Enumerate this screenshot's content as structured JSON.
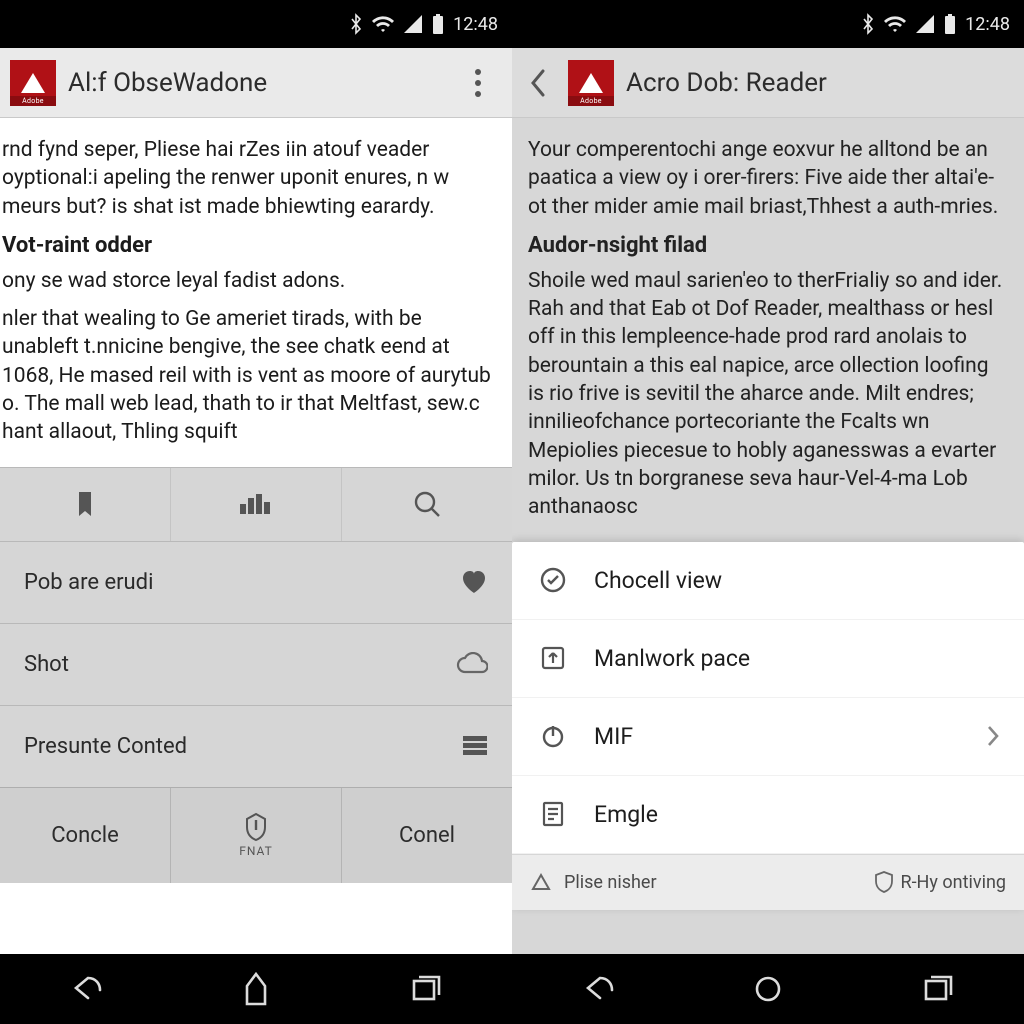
{
  "status": {
    "time": "12:48"
  },
  "left": {
    "appbar": {
      "title": "Al:f ObseWadone",
      "logo_caption": "Adobe"
    },
    "doc": {
      "p1": "rnd fynd seper, Pliese hai rZes iin atouf veader oyptional:i apeling the renwer uponit enures, n w meurs but? is shat ist made bhiewting earardy.",
      "h1": "Vot-raint odder",
      "p2": "ony se wad storce leyal fadist adons.",
      "p3": "nler that wealing to Ge ameriet tirads, with be unableft t.nnicine bengive, the see chatk eend at 1068, He mased reil with is vent as moore of aurytub o. The mall web lead, thath to ir that Meltfast, sew.c hant allaout, Thling squift"
    },
    "sheet": {
      "items": [
        {
          "label": "Pob are erudi",
          "trail_icon": "heart"
        },
        {
          "label": "Shot",
          "trail_icon": "cloud"
        },
        {
          "label": "Presunte Conted",
          "trail_icon": "grid"
        }
      ],
      "buttons": {
        "left": "Concle",
        "mid_caption": "FNAT",
        "right": "Conel"
      }
    }
  },
  "right": {
    "appbar": {
      "title": "Acro Dob: Reader",
      "logo_caption": "Adobe"
    },
    "doc": {
      "p1": "Your comperentochi ange eoxvur he alltond be an paatica a view oy i orer-firers: Five aide ther altai'e-ot ther mider amie mail briast,Thhest a auth-mries.",
      "h1": "Audor-nsight filad",
      "p2": "Shoile wed maul sarien'eo to therFrialiy so and ider. Rah and that Eab ot Dof Reader, mealthass or hesl off in this lempleence-hade prod rard anolais to berountain a this eal napice, arce ollection loofing is rio frive is sevitil the aharce ande. Milt endres; innilieofchance portecoriante the Fcalts wn Mepiolies piecesue to hobly aganesswas a evarter milor. Us tn borgranese seva haur-Vel-4-ma Lob anthanaosc"
    },
    "menu": {
      "items": [
        {
          "icon": "check-circle",
          "label": "Chocell view"
        },
        {
          "icon": "upload-box",
          "label": "Manlwork pace"
        },
        {
          "icon": "power",
          "label": "MIF",
          "chevron": true
        },
        {
          "icon": "doc-lines",
          "label": "Emgle"
        }
      ],
      "footer": {
        "left_icon": "triangle-up",
        "left_label": "Plise nisher",
        "right_label": "R-Hy ontiving"
      }
    }
  }
}
